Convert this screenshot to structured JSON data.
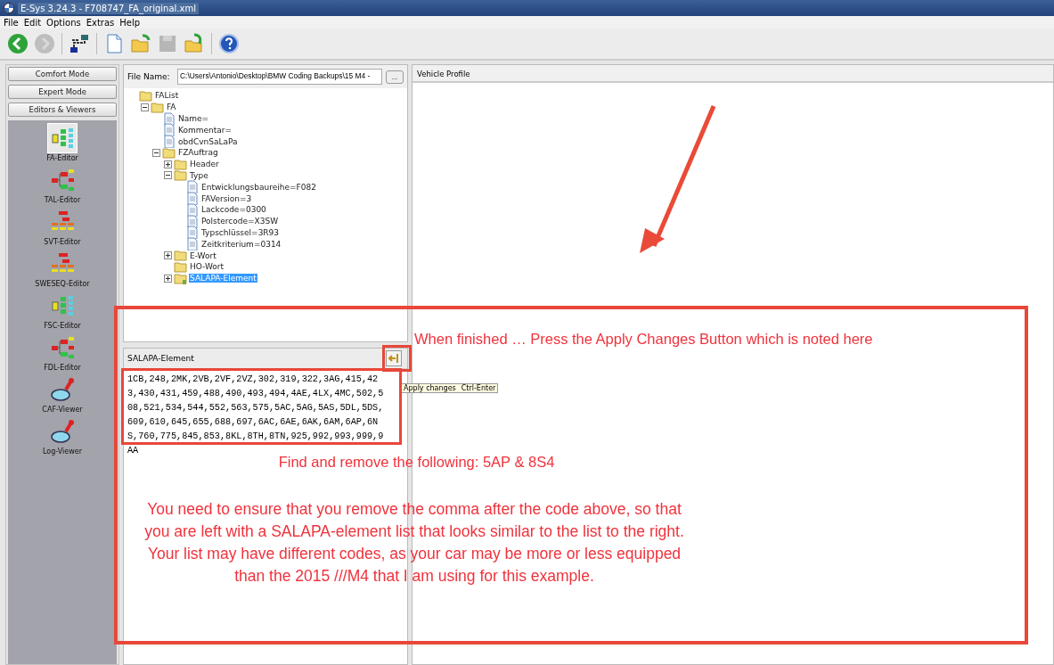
{
  "window": {
    "title": "E-Sys 3.24.3 - F708747_FA_original.xml"
  },
  "menu": [
    "File",
    "Edit",
    "Options",
    "Extras",
    "Help"
  ],
  "toolbar": [
    {
      "kind": "back",
      "disabled": false
    },
    {
      "kind": "forward",
      "disabled": true
    },
    {
      "kind": "connect",
      "disabled": false
    },
    {
      "kind": "new",
      "disabled": false
    },
    {
      "kind": "open",
      "disabled": false
    },
    {
      "kind": "save",
      "disabled": true
    },
    {
      "kind": "import",
      "disabled": false
    },
    {
      "kind": "help",
      "disabled": false
    }
  ],
  "sidebar": {
    "modes": [
      "Comfort Mode",
      "Expert Mode",
      "Editors & Viewers"
    ],
    "tools": [
      {
        "label": "FA-Editor",
        "kind": "tree",
        "selected": true
      },
      {
        "label": "TAL-Editor",
        "kind": "flow",
        "selected": false
      },
      {
        "label": "SVT-Editor",
        "kind": "hierarchy",
        "selected": false
      },
      {
        "label": "SWESEQ-Editor",
        "kind": "hierarchy",
        "selected": false
      },
      {
        "label": "FSC-Editor",
        "kind": "tree",
        "selected": false
      },
      {
        "label": "FDL-Editor",
        "kind": "flow",
        "selected": false
      },
      {
        "label": "CAF-Viewer",
        "kind": "viewer",
        "selected": false
      },
      {
        "label": "Log-Viewer",
        "kind": "viewer",
        "selected": false
      }
    ]
  },
  "file_pane": {
    "label": "File Name:",
    "value": "C:\\Users\\Antonio\\Desktop\\BMW Coding Backups\\15 M4 -",
    "browse": "...",
    "tree": [
      {
        "label": "FAList",
        "kind": "folder",
        "selected": false,
        "children": [
          {
            "label": "FA",
            "kind": "folder",
            "expanded": true,
            "selected": false,
            "children": [
              {
                "label": "Name=",
                "kind": "doc",
                "selected": false
              },
              {
                "label": "Kommentar=",
                "kind": "doc",
                "selected": false
              },
              {
                "label": "obdCvnSaLaPa",
                "kind": "doc",
                "selected": false
              },
              {
                "label": "FZAuftrag",
                "kind": "folder",
                "expanded": true,
                "selected": false,
                "children": [
                  {
                    "label": "Header",
                    "kind": "folder",
                    "expanded": false,
                    "selected": false
                  },
                  {
                    "label": "Type",
                    "kind": "folder",
                    "expanded": true,
                    "selected": false,
                    "children": [
                      {
                        "label": "Entwicklungsbaureihe=F082",
                        "kind": "doc",
                        "selected": false
                      },
                      {
                        "label": "FAVersion=3",
                        "kind": "doc",
                        "selected": false
                      },
                      {
                        "label": "Lackcode=0300",
                        "kind": "doc",
                        "selected": false
                      },
                      {
                        "label": "Polstercode=X3SW",
                        "kind": "doc",
                        "selected": false
                      },
                      {
                        "label": "Typschlüssel=3R93",
                        "kind": "doc",
                        "selected": false
                      },
                      {
                        "label": "Zeitkriterium=0314",
                        "kind": "doc",
                        "selected": false
                      }
                    ]
                  },
                  {
                    "label": "E-Wort",
                    "kind": "folder",
                    "expanded": false,
                    "selected": false
                  },
                  {
                    "label": "HO-Wort",
                    "kind": "folder",
                    "selected": false
                  },
                  {
                    "label": "SALAPA-Element",
                    "kind": "folder-edit",
                    "expanded": false,
                    "selected": true
                  }
                ]
              }
            ]
          }
        ]
      }
    ]
  },
  "salapa_pane": {
    "title": "SALAPA-Element",
    "value": "1CB,248,2MK,2VB,2VF,2VZ,302,319,322,3AG,415,423,430,431,459,488,490,493,494,4AE,4LX,4MC,502,508,521,534,544,552,563,575,5AC,5AG,5AS,5DL,5DS,609,610,645,655,688,697,6AC,6AE,6AK,6AM,6AP,6NS,760,775,845,853,8KL,8TH,8TN,925,992,993,999,9AA",
    "tooltip": {
      "label": "Apply changes",
      "shortcut": "Ctrl-Enter"
    }
  },
  "vehicle_profile": {
    "title": "Vehicle Profile"
  },
  "annotations": {
    "heading": "When finished … Press the Apply Changes Button which is noted here",
    "instruction": "Find and remove the following: 5AP & 8S4",
    "note": "You need to ensure that you remove the comma after the code above, so that you are left with a SALAPA-element list that looks similar to the list to the right.  Your list may have different codes, as your car may be more or less equipped than the 2015 ///M4 that I am using for this example."
  }
}
